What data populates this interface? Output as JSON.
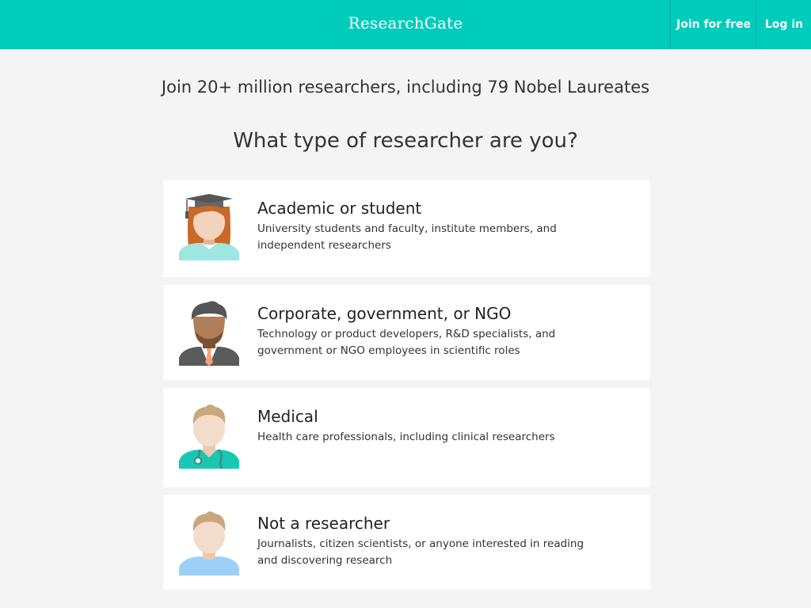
{
  "header": {
    "logo": "ResearchGate",
    "join_label": "Join for free",
    "login_label": "Log in"
  },
  "main": {
    "tagline": "Join 20+ million researchers, including 79 Nobel Laureates",
    "question": "What type of researcher are you?",
    "options": [
      {
        "title": "Academic or student",
        "description": "University students and faculty, institute members, and independent researchers",
        "icon": "academic-avatar-icon"
      },
      {
        "title": "Corporate, government, or NGO",
        "description": "Technology or product developers, R&D specialists, and government or NGO employees in scientific roles",
        "icon": "corporate-avatar-icon"
      },
      {
        "title": "Medical",
        "description": "Health care professionals, including clinical researchers",
        "icon": "medical-avatar-icon"
      },
      {
        "title": "Not a researcher",
        "description": "Journalists, citizen scientists, or anyone interested in reading and discovering research",
        "icon": "non-researcher-avatar-icon"
      }
    ]
  },
  "colors": {
    "brand": "#00ccbb",
    "background": "#f4f4f4",
    "card": "#ffffff"
  }
}
